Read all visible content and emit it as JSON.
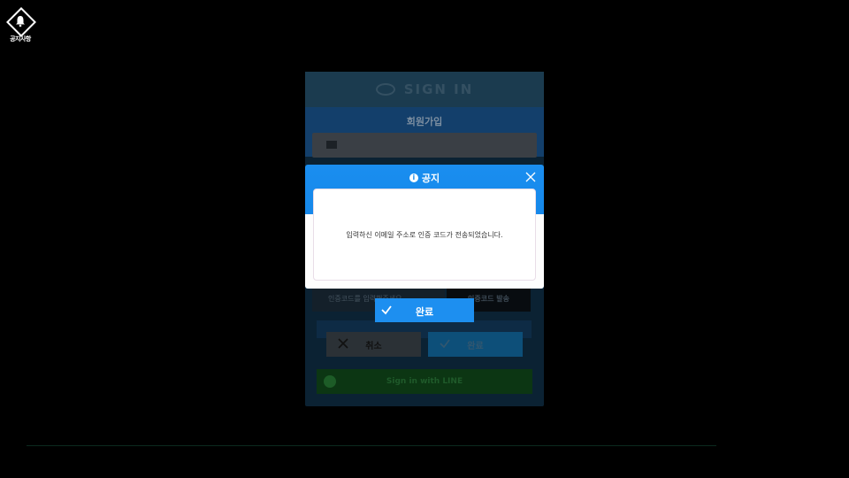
{
  "corner": {
    "notice_label": "공지사항"
  },
  "signup": {
    "logo_text": "SIGN IN",
    "title": "회원가입",
    "code_placeholder": "인증코드를 입력해주세요",
    "send_code_label": "인증코드 발송",
    "cancel_label": "취소",
    "confirm_label": "완료",
    "line_label": "Sign in with LINE"
  },
  "dialog": {
    "title": "공지",
    "message": "입력하신 이메일 주소로 인증 코드가 전송되었습니다.",
    "ok_label": "완료"
  },
  "colors": {
    "accent": "#1a8ef0",
    "overlay": "#000000"
  }
}
